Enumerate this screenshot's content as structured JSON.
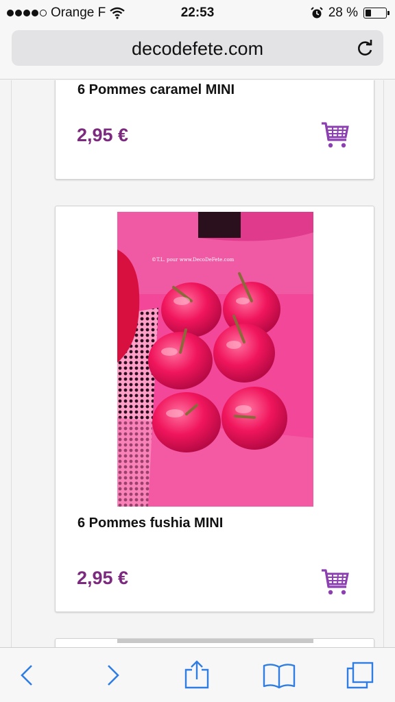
{
  "status_bar": {
    "carrier": "Orange F",
    "time": "22:53",
    "battery": "28 %",
    "battery_level": 0.28,
    "icons": [
      "signal-dots",
      "wifi-icon",
      "alarm-icon",
      "battery-icon"
    ]
  },
  "browser": {
    "url": "decodefete.com",
    "reload_icon": "reload-icon"
  },
  "products": [
    {
      "title": "6 Pommes caramel MINI",
      "price": "2,95 €"
    },
    {
      "title": "6 Pommes fushia MINI",
      "price": "2,95 €",
      "watermark": "©T.L. pour www.DecoDeFete.com"
    }
  ],
  "toolbar": {
    "icons": [
      "back-icon",
      "forward-icon",
      "share-icon",
      "bookmarks-icon",
      "tabs-icon"
    ]
  },
  "colors": {
    "price": "#7b2a7e",
    "cart": "#8b3fb0",
    "toolbar_icon": "#2f7de1",
    "product_bg": "#f02a7e"
  }
}
